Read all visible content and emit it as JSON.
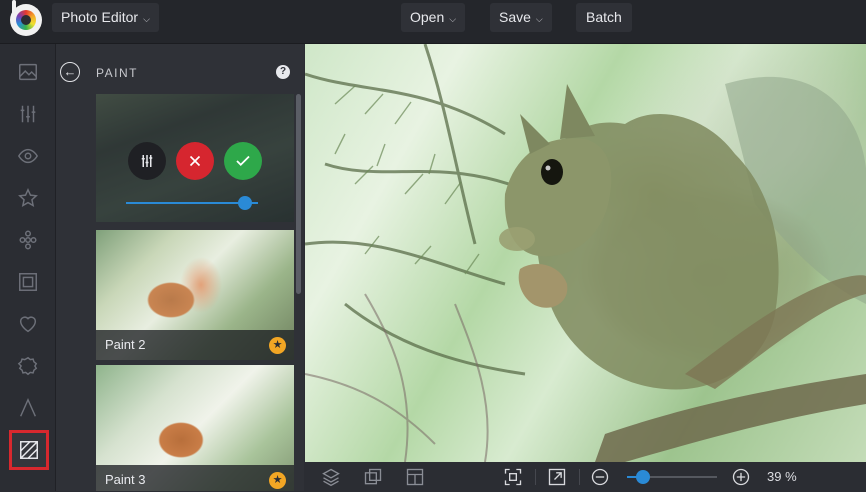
{
  "header": {
    "app_title": "Photo Editor",
    "open_label": "Open",
    "save_label": "Save",
    "batch_label": "Batch"
  },
  "rail": {
    "items": [
      "image-icon",
      "sliders-icon",
      "eye-icon",
      "star-icon",
      "effects-icon",
      "frame-icon",
      "heart-icon",
      "sticker-icon",
      "text-icon",
      "paint-icon"
    ],
    "active": "paint-icon"
  },
  "panel": {
    "title": "PAINT",
    "intensity": 0.9,
    "thumbnails": [
      {
        "label": "Paint 2"
      },
      {
        "label": "Paint 3"
      }
    ]
  },
  "zoom": {
    "value": "39 %",
    "level": 0.18
  },
  "colors": {
    "accent": "#2a8ad6",
    "cancel": "#d6262f",
    "apply": "#2ea84a",
    "premium": "#f2a624",
    "highlight": "#d8282e"
  }
}
